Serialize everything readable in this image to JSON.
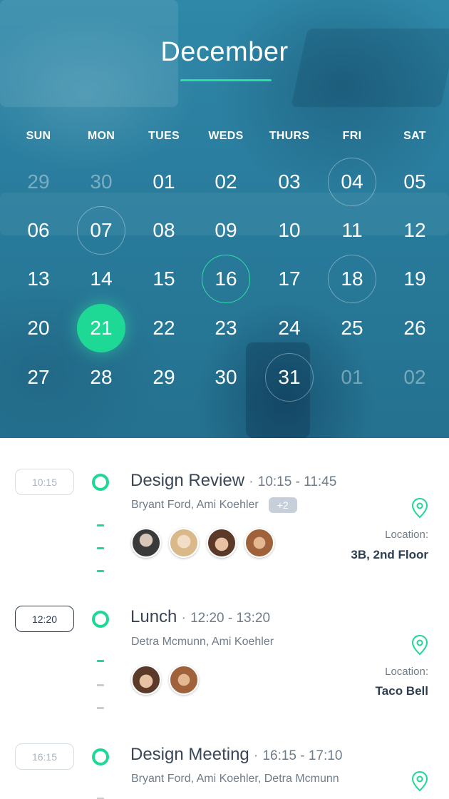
{
  "calendar": {
    "month": "December",
    "weekdays": [
      "SUN",
      "MON",
      "TUES",
      "WEDS",
      "THURS",
      "FRI",
      "SAT"
    ],
    "weeks": [
      [
        "29",
        "30",
        "01",
        "02",
        "03",
        "04",
        "05"
      ],
      [
        "06",
        "07",
        "08",
        "09",
        "10",
        "11",
        "12"
      ],
      [
        "13",
        "14",
        "15",
        "16",
        "17",
        "18",
        "19"
      ],
      [
        "20",
        "21",
        "22",
        "23",
        "24",
        "25",
        "26"
      ],
      [
        "27",
        "28",
        "29",
        "30",
        "31",
        "01",
        "02"
      ]
    ],
    "selected_day": "21",
    "today_day": "16",
    "event_days": [
      "04",
      "07",
      "18",
      "31"
    ],
    "accent_color": "#1ed895"
  },
  "events": [
    {
      "time": "10:15",
      "title": "Design Review",
      "separator": "·",
      "range": "10:15 - 11:45",
      "people": "Bryant Ford, Ami Koehler",
      "more": "+2",
      "location_label": "Location:",
      "location": "3B, 2nd Floor",
      "icon": "location-pin-icon"
    },
    {
      "time": "12:20",
      "title": "Lunch",
      "separator": "·",
      "range": "12:20 - 13:20",
      "people": "Detra Mcmunn, Ami Koehler",
      "location_label": "Location:",
      "location": "Taco Bell",
      "icon": "location-pin-icon"
    },
    {
      "time": "16:15",
      "title": "Design Meeting",
      "separator": "·",
      "range": "16:15 - 17:10",
      "people": "Bryant Ford, Ami Koehler, Detra Mcmunn",
      "icon": "location-pin-icon"
    }
  ]
}
